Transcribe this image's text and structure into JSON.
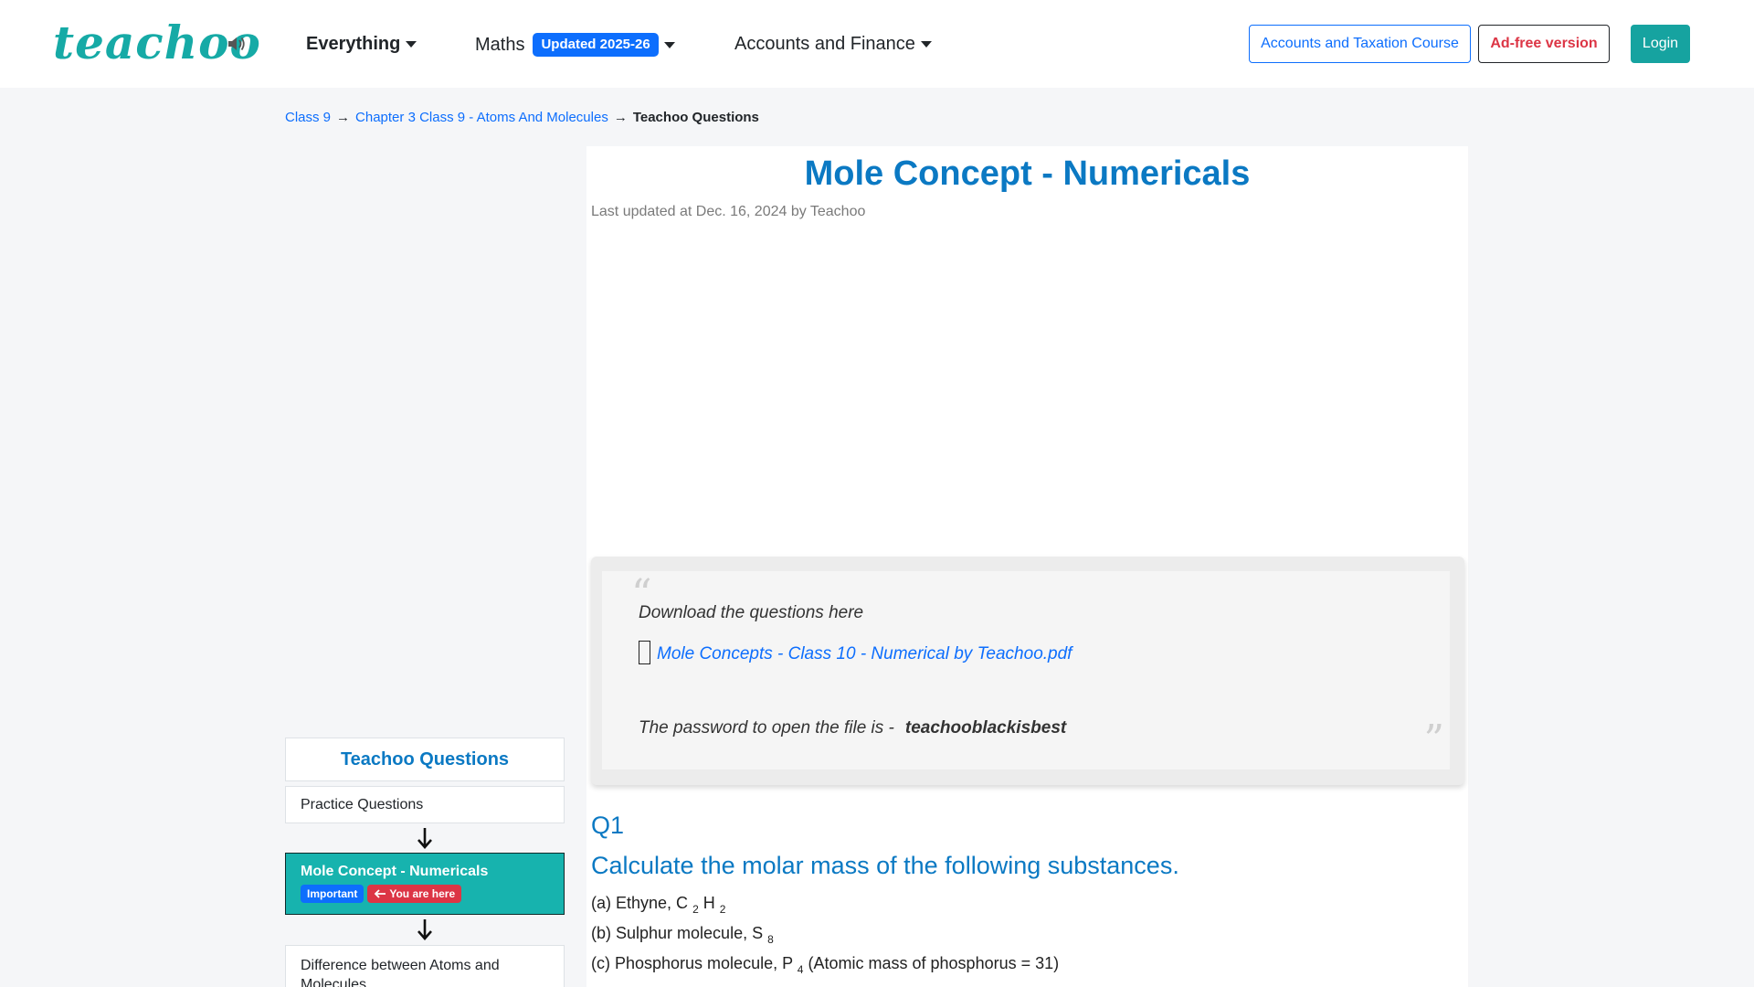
{
  "nav": {
    "logo": "teachoo",
    "everything": "Everything",
    "maths": "Maths",
    "maths_badge": "Updated 2025-26",
    "accounts": "Accounts and Finance",
    "course_button": "Accounts and Taxation Course",
    "adfree_button": "Ad-free version",
    "login_button": "Login"
  },
  "breadcrumb": {
    "items": [
      "Class 9",
      "Chapter 3 Class 9 - Atoms And Molecules"
    ],
    "separator": "→",
    "current": "Teachoo Questions"
  },
  "sidebar": {
    "title": "Teachoo Questions",
    "practice": "Practice Questions",
    "active": "Mole Concept - Numericals",
    "tag_important": "Important",
    "tag_here": "You are here",
    "next": "Difference between Atoms and Molecules"
  },
  "main": {
    "title": "Mole Concept - Numericals",
    "updated": "Last updated at Dec. 16, 2024 by Teachoo",
    "quote_text": "Download the questions here",
    "file_link": "Mole Concepts - Class 10 - Numerical by Teachoo.pdf",
    "password_label": "The password to open the file is -",
    "password": "teachooblackisbest",
    "q_number": "Q1",
    "q_heading": "Calculate the molar mass of the following substances.",
    "parts": {
      "a_prefix": "(a) Ethyne, C",
      "a_sub1": "2",
      "a_mid": "H",
      "a_sub2": "2",
      "b_prefix": "(b) Sulphur molecule, S",
      "b_sub": "8",
      "c_prefix": "(c) Phosphorus molecule, P",
      "c_sub": "4",
      "c_suffix": "(Atomic mass of phosphorus = 31)"
    }
  },
  "colors": {
    "brand_teal": "#16aaa6",
    "title_blue": "#0b79c3",
    "link_blue": "#0d6efd",
    "danger_red": "#dc3545"
  },
  "icons": [
    "speaker-icon",
    "caret-down-icon",
    "arrow-left-icon",
    "arrow-down-icon",
    "file-icon"
  ]
}
